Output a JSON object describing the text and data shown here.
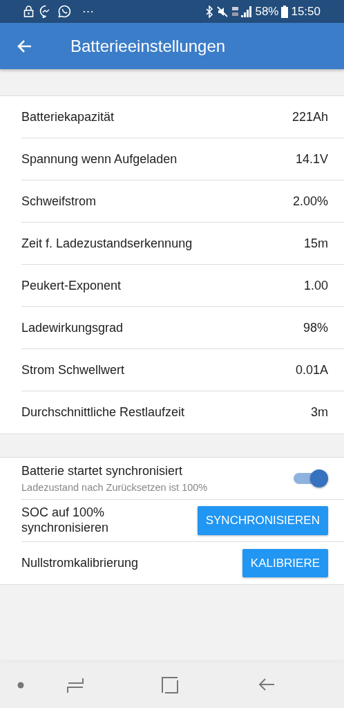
{
  "status_bar": {
    "more": "⋯",
    "battery": "58%",
    "time": "15:50"
  },
  "app_bar": {
    "title": "Batterieeinstellungen"
  },
  "settings": [
    {
      "label": "Batteriekapazität",
      "value": "221Ah"
    },
    {
      "label": "Spannung wenn Aufgeladen",
      "value": "14.1V"
    },
    {
      "label": "Schweifstrom",
      "value": "2.00%"
    },
    {
      "label": "Zeit f. Ladezustandserkennung",
      "value": "15m"
    },
    {
      "label": "Peukert-Exponent",
      "value": "1.00"
    },
    {
      "label": "Ladewirkungsgrad",
      "value": "98%"
    },
    {
      "label": "Strom Schwellwert",
      "value": "0.01A"
    },
    {
      "label": "Durchschnittliche Restlaufzeit",
      "value": "3m"
    }
  ],
  "actions": [
    {
      "kind": "toggle",
      "label": "Batterie startet synchronisiert",
      "subtitle": "Ladezustand nach Zurücksetzen ist 100%",
      "checked": true
    },
    {
      "kind": "button",
      "label": "SOC auf 100%\nsynchronisieren",
      "button": "SYNCHRONISIEREN"
    },
    {
      "kind": "button",
      "label": "Nullstromkalibrierung",
      "button": "KALIBRIERE"
    }
  ]
}
